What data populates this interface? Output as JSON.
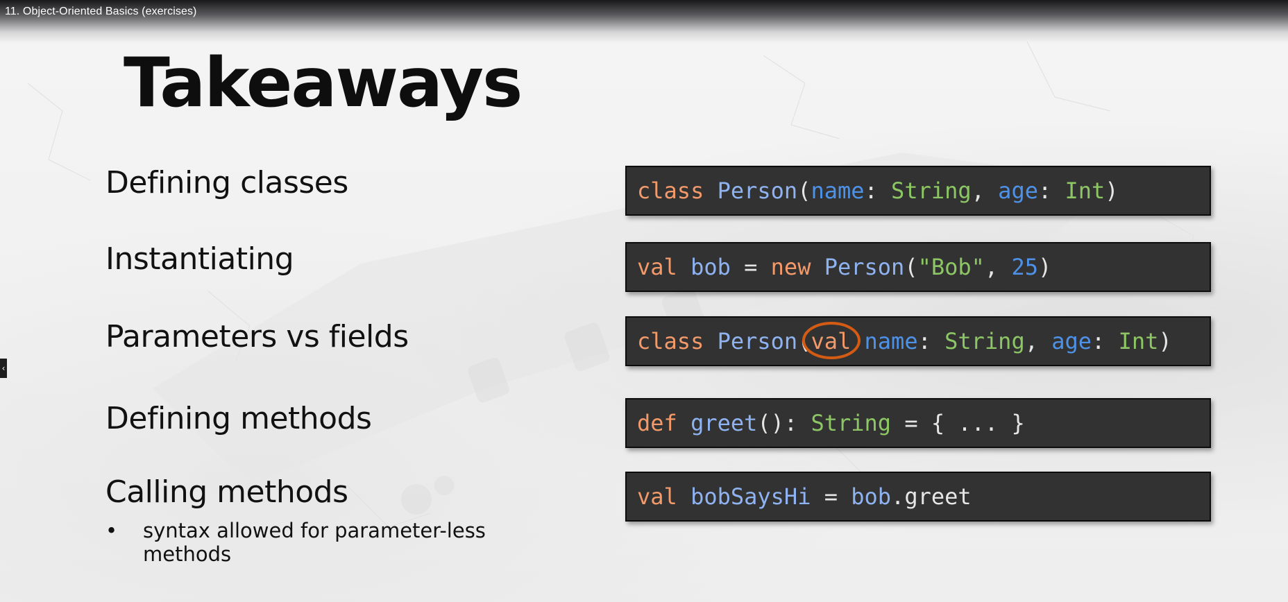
{
  "player": {
    "video_title": "11. Object-Oriented Basics (exercises)",
    "side_arrow": "‹"
  },
  "slide": {
    "title": "Takeaways",
    "takeaways": [
      "Defining classes",
      "Instantiating",
      "Parameters vs fields",
      "Defining methods",
      "Calling methods"
    ],
    "bullet": {
      "marker": "•",
      "text": "syntax allowed for parameter-less methods"
    }
  },
  "code": {
    "line1": [
      "class",
      " ",
      "Person",
      "(",
      "name",
      ": ",
      "String",
      ", ",
      "age",
      ": ",
      "Int",
      ")"
    ],
    "line2": [
      "val",
      " ",
      "bob",
      " = ",
      "new",
      " ",
      "Person",
      "(",
      "\"Bob\"",
      ", ",
      "25",
      ")"
    ],
    "line3": [
      "class",
      " ",
      "Person",
      "(",
      "val",
      " ",
      "name",
      ": ",
      "String",
      ", ",
      "age",
      ": ",
      "Int",
      ")"
    ],
    "line4": [
      "def",
      " ",
      "greet",
      "(): ",
      "String",
      " = { ... }"
    ],
    "line5": [
      "val",
      " ",
      "bobSaysHi",
      " = ",
      "bob",
      ".greet"
    ]
  },
  "colors": {
    "keyword": "#f39a6a",
    "type": "#8fb3f0",
    "param": "#4e92e8",
    "string": "#8cc665",
    "number": "#4e92e8",
    "highlight_circle": "#d45b14",
    "code_background": "#333232"
  }
}
